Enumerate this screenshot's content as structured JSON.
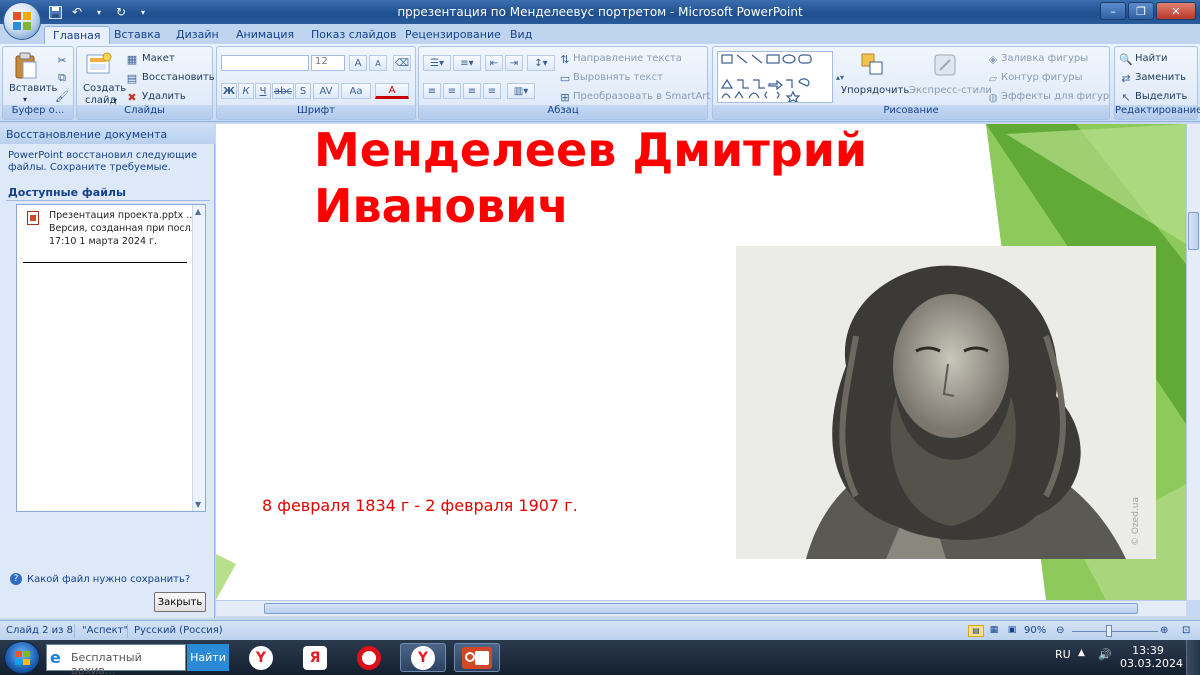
{
  "window": {
    "title": "пррезентация по Менделеевус портретом - Microsoft PowerPoint"
  },
  "ribbon_tabs": [
    "Главная",
    "Вставка",
    "Дизайн",
    "Анимация",
    "Показ слайдов",
    "Рецензирование",
    "Вид"
  ],
  "ribbon": {
    "clipboard": {
      "paste": "Вставить",
      "label": "Буфер о..."
    },
    "slides": {
      "create_line1": "Создать",
      "create_line2": "слайд",
      "layout": "Макет",
      "reset": "Восстановить",
      "delete": "Удалить",
      "label": "Слайды"
    },
    "font": {
      "size": "12",
      "bold": "Ж",
      "italic": "К",
      "underline": "Ч",
      "strike": "abc",
      "shadow": "S",
      "spacing": "AV",
      "case": "Aa",
      "color": "A",
      "grow": "A",
      "shrink": "A",
      "label": "Шрифт"
    },
    "paragraph": {
      "text_direction": "Направление текста",
      "align_text": "Выровнять текст",
      "smartart": "Преобразовать в SmartArt",
      "label": "Абзац"
    },
    "drawing": {
      "arrange": "Упорядочить",
      "quick_styles": "Экспресс-стили",
      "shape_fill": "Заливка фигуры",
      "shape_outline": "Контур фигуры",
      "shape_effects": "Эффекты для фигур",
      "label": "Рисование"
    },
    "editing": {
      "find": "Найти",
      "replace": "Заменить",
      "select": "Выделить",
      "label": "Редактирование"
    }
  },
  "recovery_pane": {
    "header": "Восстановление документа",
    "message": "PowerPoint восстановил следующие файлы. Сохраните требуемые.",
    "available_label": "Доступные файлы",
    "file": {
      "name": "Презентация проекта.pptx ...",
      "version": "Версия, созданная при посл...",
      "time": "17:10 1 марта 2024 г."
    },
    "help_link": "Какой файл нужно сохранить?",
    "close_button": "Закрыть"
  },
  "slide": {
    "title_line1": "Менделеев Дмитрий",
    "title_line2": "Иванович",
    "dates": "8 февраля 1834 г - 2 февраля 1907 г.",
    "photo_caption": "© Ozed.ua"
  },
  "status": {
    "slide_count": "Слайд 2 из 8",
    "theme": "\"Аспект\"",
    "language": "Русский (Россия)",
    "zoom": "90%"
  },
  "taskbar": {
    "search_placeholder": "Бесплатный архив...",
    "search_button": "Найти",
    "lang": "RU",
    "time": "13:39",
    "date": "03.03.2024"
  },
  "colors": {
    "title_red": "#ff0000",
    "slide_green": "#7dc142",
    "ribbon_blue": "#15428b"
  }
}
